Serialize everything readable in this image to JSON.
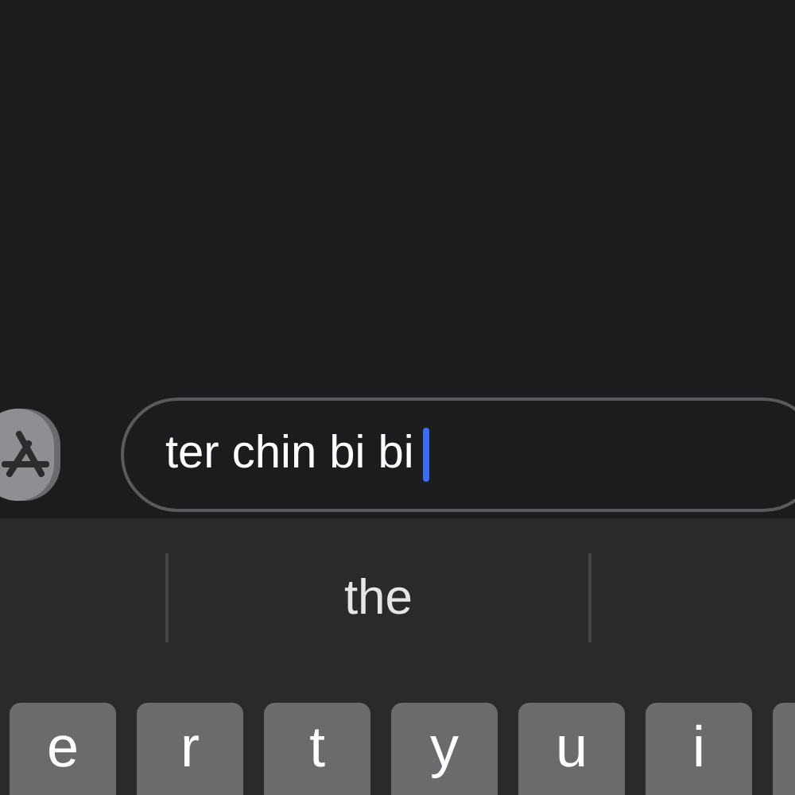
{
  "message_field": {
    "value": "ter chin bi bi",
    "focused": true
  },
  "suggestions": [
    "the"
  ],
  "keys": [
    "e",
    "r",
    "t",
    "y",
    "u",
    "i"
  ]
}
